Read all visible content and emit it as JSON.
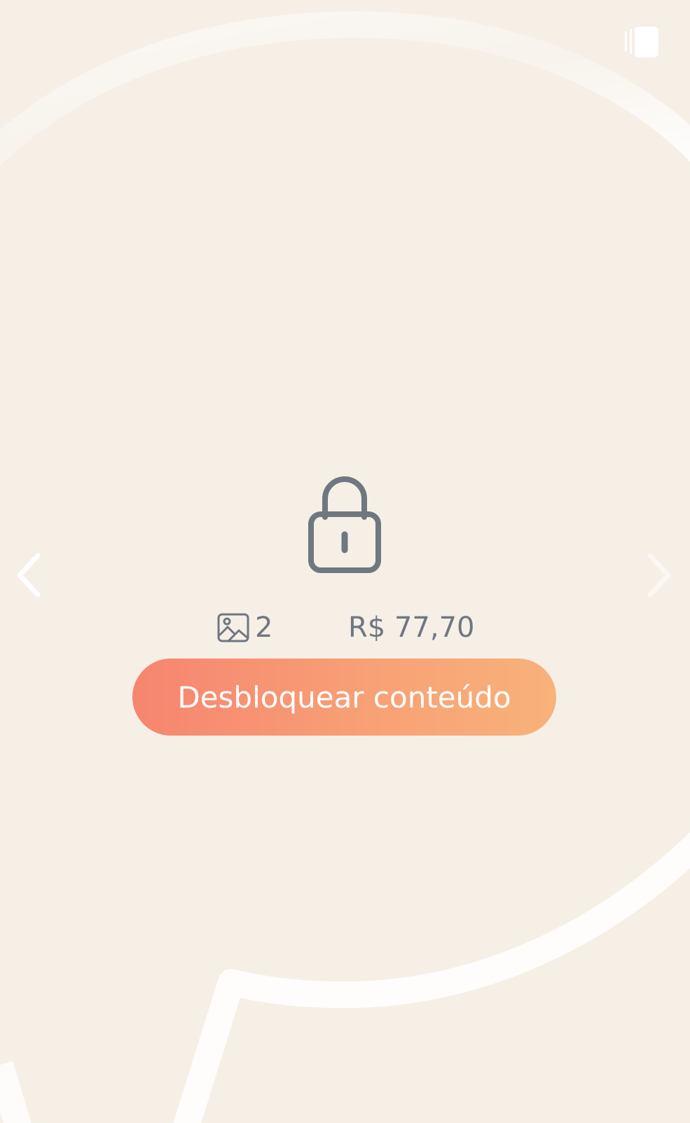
{
  "colors": {
    "background": "#f5efe6",
    "icon": "#6f7780",
    "button_start": "#f6856f",
    "button_end": "#f8b27a",
    "button_text": "#ffffff"
  },
  "header": {
    "gallery_toggle_icon": "gallery-toggle-icon"
  },
  "navigation": {
    "prev_icon": "chevron-left-icon",
    "next_icon": "chevron-right-icon"
  },
  "locked_content": {
    "lock_icon": "lock-icon",
    "image_count": "2",
    "image_icon": "image-icon",
    "price": "R$ 77,70",
    "unlock_label": "Desbloquear conteúdo"
  }
}
